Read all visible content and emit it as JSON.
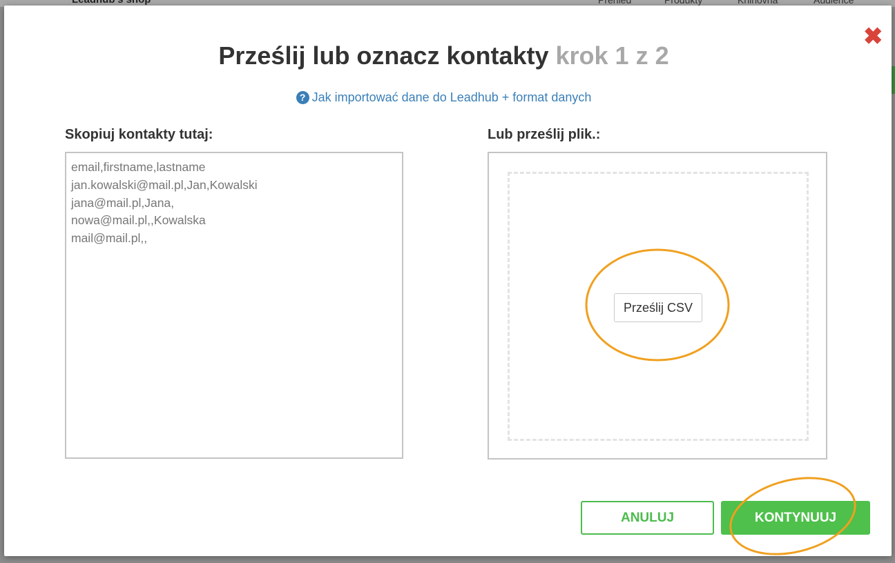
{
  "background": {
    "brand": "Leadhub's shop",
    "nav": [
      "Přehled",
      "Produkty",
      "Knihovna",
      "Audience"
    ]
  },
  "modal": {
    "close_icon": "close-icon",
    "title": "Prześlij lub oznacz kontakty",
    "step": "krok 1 z 2",
    "help_icon": "question-circle-icon",
    "help_link": "Jak importować dane do Leadhub + format danych",
    "paste_label": "Skopiuj kontakty tutaj:",
    "paste_lines": [
      "email,firstname,lastname",
      "jan.kowalski@mail.pl,Jan,Kowalski",
      "jana@mail.pl,Jana,",
      "nowa@mail.pl,,Kowalska",
      "mail@mail.pl,,"
    ],
    "upload_label": "Lub prześlij plik.:",
    "upload_button": "Prześlij CSV",
    "cancel_button": "ANULUJ",
    "continue_button": "KONTYNUUJ"
  },
  "colors": {
    "accent_green": "#4ec04b",
    "link_blue": "#3a7fb8",
    "close_red": "#d9443a",
    "highlight_orange": "#f0a020"
  }
}
